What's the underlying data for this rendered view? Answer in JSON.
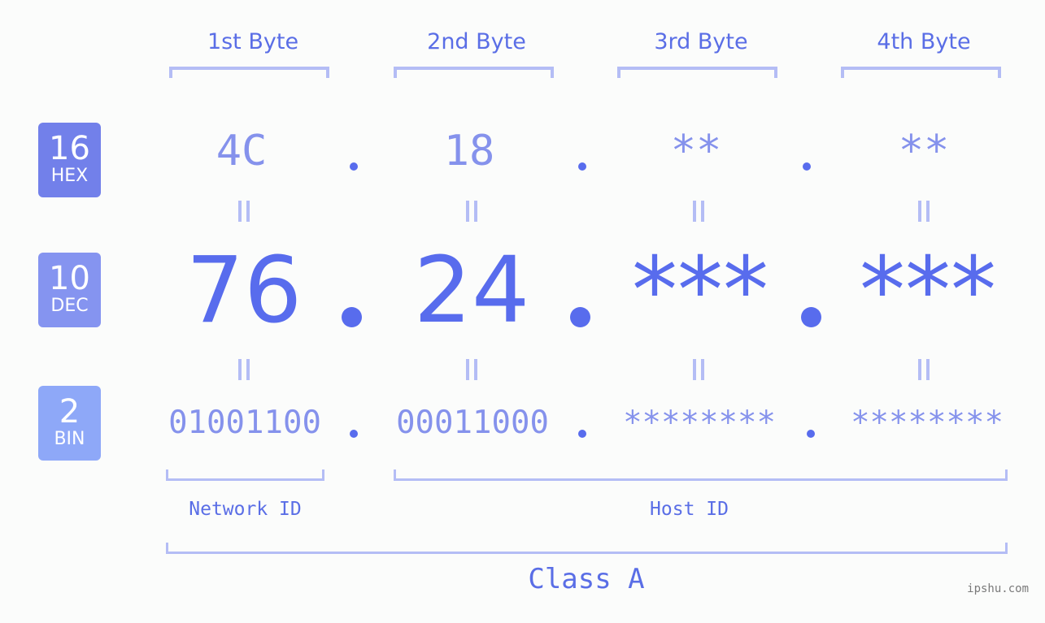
{
  "colors": {
    "hex_badge": "#7280ea",
    "dec_badge": "#8594f0",
    "bin_badge": "#8ea8f8",
    "accent": "#586ced",
    "light_text": "#8592ec",
    "bracket": "#b4bdf5"
  },
  "badges": [
    {
      "number": "16",
      "label": "HEX"
    },
    {
      "number": "10",
      "label": "DEC"
    },
    {
      "number": "2",
      "label": "BIN"
    }
  ],
  "bytes": [
    {
      "header": "1st Byte",
      "hex": "4C",
      "dec": "76",
      "bin": "01001100"
    },
    {
      "header": "2nd Byte",
      "hex": "18",
      "dec": "24",
      "bin": "00011000"
    },
    {
      "header": "3rd Byte",
      "hex": "**",
      "dec": "***",
      "bin": "********"
    },
    {
      "header": "4th Byte",
      "hex": "**",
      "dec": "***",
      "bin": "********"
    }
  ],
  "segments": {
    "network_id": "Network ID",
    "host_id": "Host ID"
  },
  "ip_class": "Class A",
  "footer": "ipshu.com"
}
